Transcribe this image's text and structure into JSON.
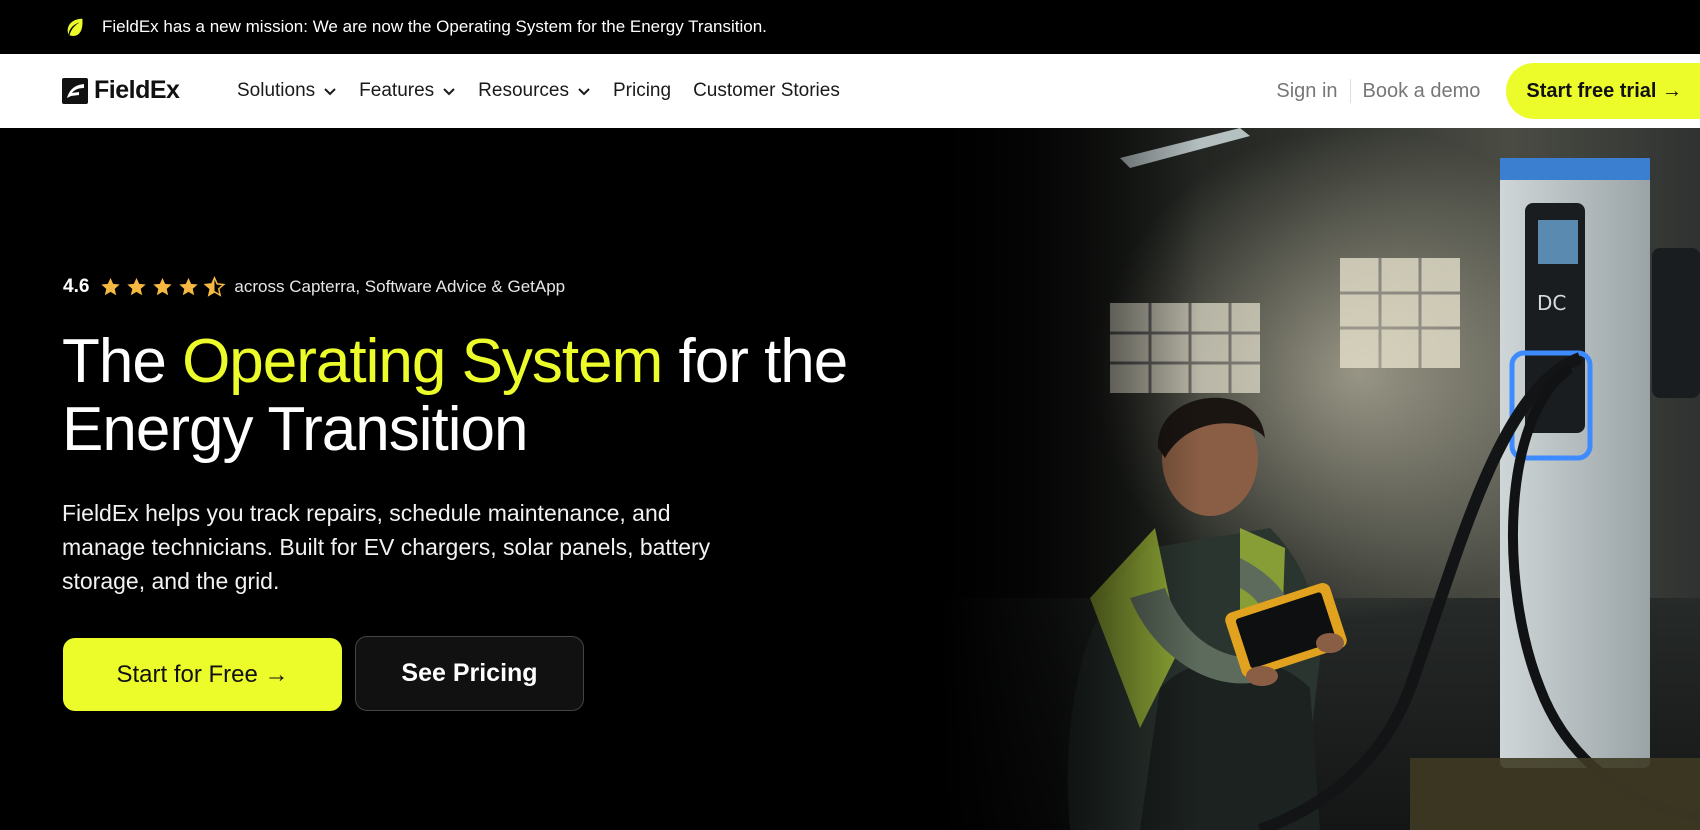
{
  "announcement": {
    "icon": "leaf-icon",
    "text": "FieldEx has a new mission: We are now the Operating System for the Energy Transition."
  },
  "nav": {
    "logo_text": "FieldEx",
    "menu": [
      {
        "label": "Solutions",
        "has_dropdown": true
      },
      {
        "label": "Features",
        "has_dropdown": true
      },
      {
        "label": "Resources",
        "has_dropdown": true
      },
      {
        "label": "Pricing",
        "has_dropdown": false
      },
      {
        "label": "Customer Stories",
        "has_dropdown": false
      }
    ],
    "sign_in": "Sign in",
    "book_demo": "Book a demo",
    "start_trial": "Start free trial →"
  },
  "hero": {
    "rating_score": "4.6",
    "rating_stars": 4.5,
    "rating_source": "across Capterra, Software Advice & GetApp",
    "headline_before": "The ",
    "headline_highlight": "Operating System",
    "headline_after": " for the Energy Transition",
    "subtext": "FieldEx helps you track repairs, schedule maintenance, and manage technicians. Built for EV chargers, solar panels, battery storage, and the grid.",
    "primary_cta": "Start for Free →",
    "secondary_cta": "See Pricing",
    "image_icon": "technician-ev-charger-photo"
  },
  "colors": {
    "accent": "#ecfc2b",
    "background": "#000000",
    "nav_background": "#ffffff",
    "star": "#f5b942"
  }
}
